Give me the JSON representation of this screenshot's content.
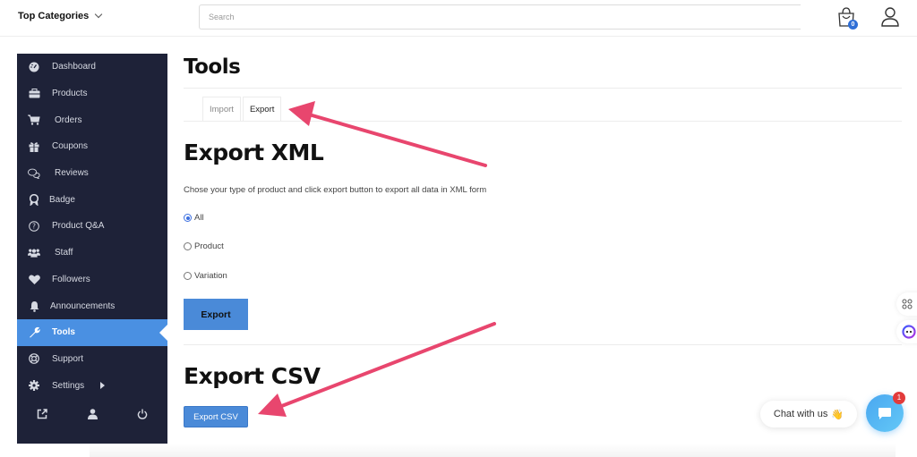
{
  "header": {
    "top_categories_label": "Top Categories",
    "search_placeholder": "Search",
    "cart_count": "0"
  },
  "sidebar": {
    "items": [
      {
        "label": "Dashboard",
        "icon": "dashboard-gauge-icon"
      },
      {
        "label": "Products",
        "icon": "briefcase-icon"
      },
      {
        "label": "Orders",
        "icon": "cart-icon"
      },
      {
        "label": "Coupons",
        "icon": "gift-icon"
      },
      {
        "label": "Reviews",
        "icon": "comments-icon"
      },
      {
        "label": "Badge",
        "icon": "award-icon"
      },
      {
        "label": "Product Q&A",
        "icon": "question-circle-icon"
      },
      {
        "label": "Staff",
        "icon": "users-icon"
      },
      {
        "label": "Followers",
        "icon": "heart-icon"
      },
      {
        "label": "Announcements",
        "icon": "bell-icon"
      },
      {
        "label": "Tools",
        "icon": "wrench-icon",
        "active": true
      },
      {
        "label": "Support",
        "icon": "life-ring-icon"
      },
      {
        "label": "Settings",
        "icon": "gear-icon"
      }
    ],
    "bottom_icons": [
      "external-link-icon",
      "user-icon",
      "power-icon"
    ]
  },
  "main": {
    "title": "Tools",
    "tabs": [
      {
        "label": "Import",
        "active": false
      },
      {
        "label": "Export",
        "active": true
      }
    ],
    "export_xml": {
      "heading": "Export XML",
      "description": "Chose your type of product and click export button to export all data in XML form",
      "options": [
        {
          "label": "All",
          "checked": true
        },
        {
          "label": "Product",
          "checked": false
        },
        {
          "label": "Variation",
          "checked": false
        }
      ],
      "button_label": "Export"
    },
    "export_csv": {
      "heading": "Export CSV",
      "button_label": "Export CSV"
    }
  },
  "chat": {
    "label": "Chat with us",
    "emoji": "👋",
    "badge_count": "1"
  },
  "colors": {
    "sidebar_bg": "#1e2238",
    "accent": "#4a8ad8",
    "arrow": "#e8466e",
    "badge_red": "#e23b3b"
  }
}
